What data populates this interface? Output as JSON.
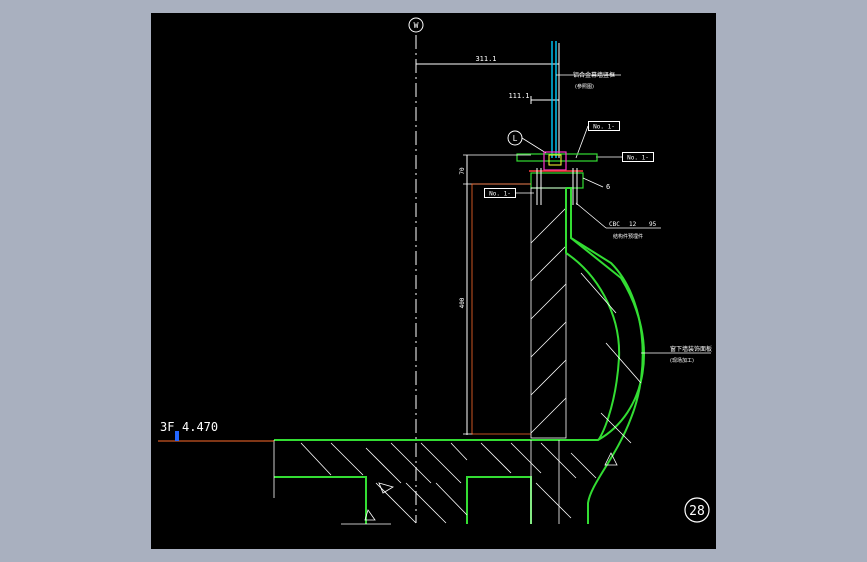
{
  "drawing": {
    "grid_bubble": "W",
    "detail_bubble": "L",
    "detail_number": "28",
    "dims": {
      "top_width": "311.1",
      "upper_width": "111.1",
      "small_height": "70",
      "main_height": "400",
      "clip_thickness": "6"
    },
    "tags": [
      "No. 1-",
      "No. 1-",
      "No. 1-"
    ],
    "level": {
      "floor": "3F",
      "elevation": "4.470"
    },
    "notes": {
      "glass_note": "铝合金幕墙竖框",
      "glass_note_sub": "(参照图)",
      "steel_note_a": "CBC",
      "steel_note_b": "12",
      "steel_note_c": "95",
      "steel_note_sub": "结构件预埋件",
      "finish_note": "窗下墙装饰面板",
      "finish_note_sub": "(现场加工)"
    },
    "colors": {
      "background": "#000000",
      "frame": "#a9b0bf",
      "concrete_outline": "#33dd33",
      "section_lines": "#ffffff",
      "dimension_lines": "#ffffff",
      "glass": "#00ccff",
      "leader": "#ff4040",
      "level_line": "#ff6b2b"
    }
  }
}
